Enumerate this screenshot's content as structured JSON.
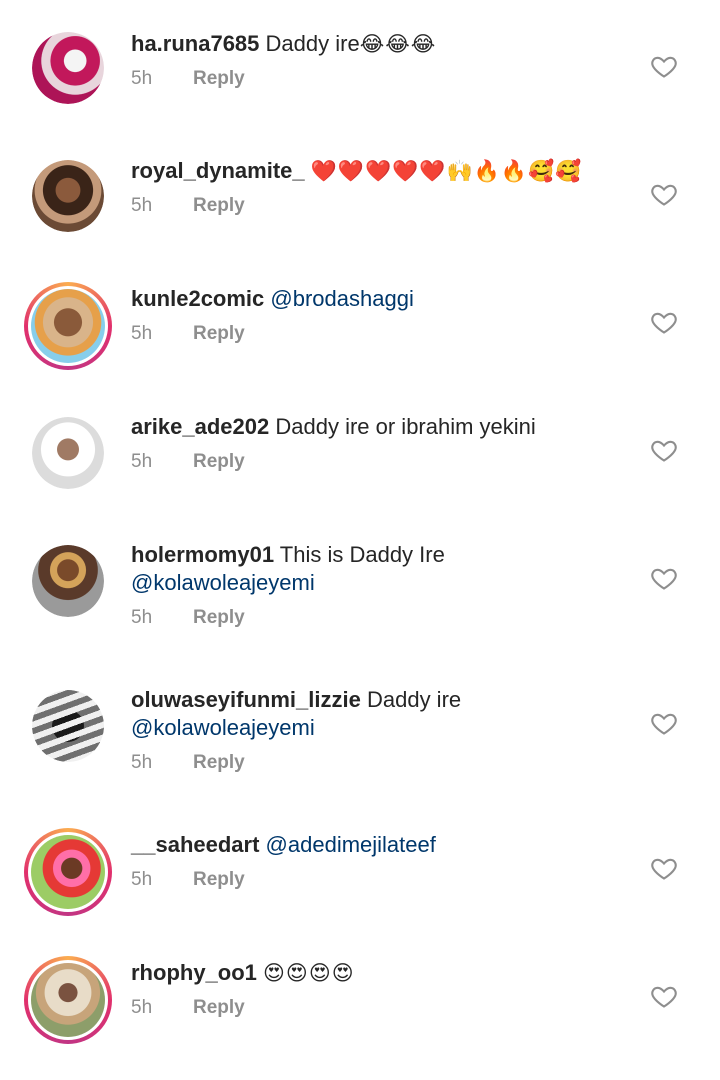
{
  "comments": [
    {
      "username": "ha.runa7685",
      "text": "Daddy ire",
      "emoji": "😂😂😂",
      "mention": "",
      "time": "5h",
      "reply": "Reply",
      "avatar": "avatar-pink-graphic"
    },
    {
      "username": "royal_dynamite_",
      "text": "",
      "emoji": "❤️❤️❤️❤️❤️🙌🔥🔥🥰🥰",
      "mention": "",
      "time": "5h",
      "reply": "Reply",
      "avatar": "avatar-woman-photo"
    },
    {
      "username": "kunle2comic",
      "text": "",
      "emoji": "",
      "mention": "@brodashaggi",
      "time": "5h",
      "reply": "Reply",
      "avatar": "avatar-man-photo"
    },
    {
      "username": "arike_ade202",
      "text": "Daddy ire or ibrahim yekini",
      "emoji": "",
      "mention": "",
      "time": "5h",
      "reply": "Reply",
      "avatar": "avatar-woman-hijab"
    },
    {
      "username": "holermomy01",
      "text": "This is Daddy Ire",
      "emoji": "",
      "mention": "@kolawoleajeyemi",
      "time": "5h",
      "reply": "Reply",
      "avatar": "avatar-woman-gele"
    },
    {
      "username": "oluwaseyifunmi_lizzie",
      "text": "Daddy ire",
      "emoji": "",
      "mention": "@kolawoleajeyemi",
      "time": "5h",
      "reply": "Reply",
      "avatar": "avatar-bw-photo"
    },
    {
      "username": "__saheedart",
      "text": "",
      "emoji": "",
      "mention": "@adedimejilateef",
      "time": "5h",
      "reply": "Reply",
      "avatar": "avatar-pink-hair"
    },
    {
      "username": "rhophy_oo1",
      "text": "",
      "emoji": "😍😍😍😍",
      "mention": "",
      "time": "5h",
      "reply": "Reply",
      "avatar": "avatar-woman-hijab-outdoor"
    }
  ],
  "icons": {
    "like": "heart-outline-icon"
  }
}
